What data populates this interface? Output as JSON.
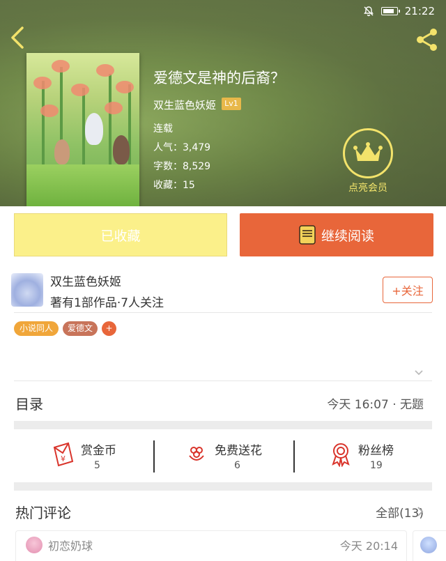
{
  "status_bar": {
    "time": "21:22",
    "icons": [
      "mute-bell-icon",
      "battery-icon"
    ]
  },
  "header": {
    "back_icon": "chevron-left-icon",
    "share_icon": "share-icon"
  },
  "book": {
    "title": "爱德文是神的后裔？",
    "author": "双生蓝色妖姬",
    "author_level": "Lv1",
    "status": "连载",
    "popularity": "人气：3,479",
    "word_count": "字数：8,529",
    "collections": "收藏：15"
  },
  "vip": {
    "label": "点亮会员",
    "icon": "crown-icon"
  },
  "actions": {
    "favorited_label": "已收藏",
    "continue_label": "继续阅读",
    "continue_icon": "book-icon"
  },
  "author_row": {
    "name": "双生蓝色妖姬",
    "meta": "著有1部作品·7人关注",
    "follow_label": "+关注"
  },
  "tags": [
    {
      "label": "小说同人",
      "color": "#f0a63a"
    },
    {
      "label": "爱德文",
      "color": "#c8745a"
    },
    {
      "label": "+",
      "color": "#e8663a"
    }
  ],
  "toc": {
    "label": "目录",
    "latest": "今天 16:07 · 无题"
  },
  "stats": [
    {
      "label": "赏金币",
      "value": "5",
      "icon": "red-envelope-icon"
    },
    {
      "label": "免费送花",
      "value": "6",
      "icon": "flower-icon"
    },
    {
      "label": "粉丝榜",
      "value": "19",
      "icon": "medal-icon"
    }
  ],
  "hot_comments": {
    "label": "热门评论",
    "all_label": "全部(13)",
    "items": [
      {
        "user": "初恋奶球",
        "time": "今天 20:14"
      }
    ]
  },
  "colors": {
    "accent": "#e8663a",
    "favorited_bg": "#fbf08a",
    "vip_gold": "#f3e36b",
    "icon_red": "#d9342b"
  }
}
